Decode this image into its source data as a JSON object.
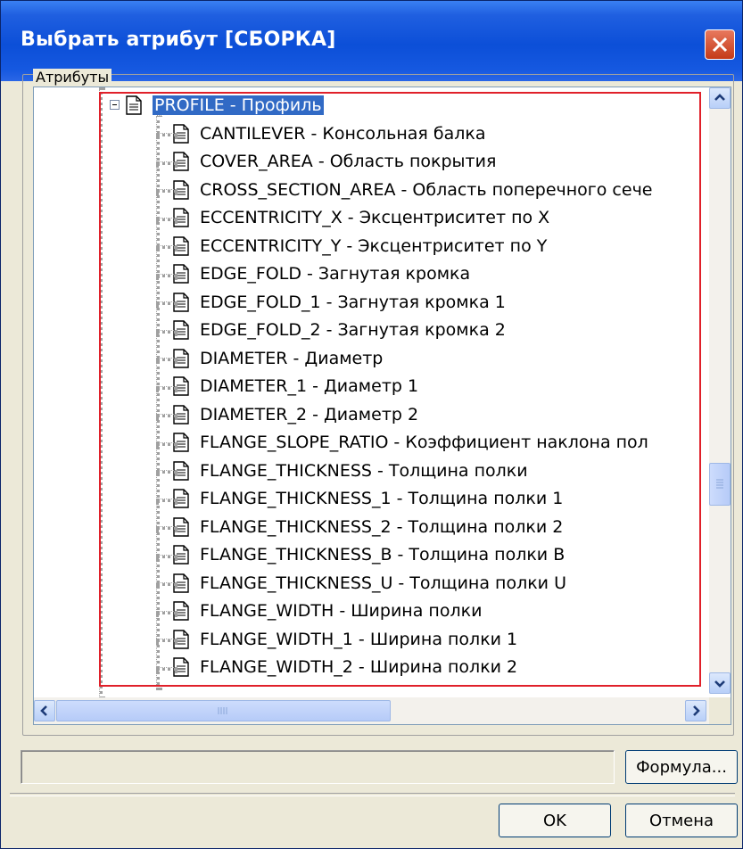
{
  "window": {
    "title": "Выбрать атрибут [СБОРКА]",
    "close_icon": "close-icon"
  },
  "group": {
    "label": "Атрибуты"
  },
  "tree": {
    "parent": {
      "label": "PROFILE  - Профиль",
      "expanded": true
    },
    "children": [
      {
        "label": "CANTILEVER  - Консольная балка"
      },
      {
        "label": "COVER_AREA  - Область покрытия"
      },
      {
        "label": "CROSS_SECTION_AREA  - Область поперечного сече"
      },
      {
        "label": "ECCENTRICITY_X  - Эксцентриситет по X"
      },
      {
        "label": "ECCENTRICITY_Y  - Эксцентриситет по Y"
      },
      {
        "label": "EDGE_FOLD  - Загнутая кромка"
      },
      {
        "label": "EDGE_FOLD_1  - Загнутая кромка 1"
      },
      {
        "label": "EDGE_FOLD_2  - Загнутая кромка 2"
      },
      {
        "label": "DIAMETER  - Диаметр"
      },
      {
        "label": "DIAMETER_1  - Диаметр 1"
      },
      {
        "label": "DIAMETER_2  - Диаметр 2"
      },
      {
        "label": "FLANGE_SLOPE_RATIO  - Коэффициент наклона пол"
      },
      {
        "label": "FLANGE_THICKNESS  - Толщина полки"
      },
      {
        "label": "FLANGE_THICKNESS_1  - Толщина полки 1"
      },
      {
        "label": "FLANGE_THICKNESS_2  - Толщина полки 2"
      },
      {
        "label": "FLANGE_THICKNESS_B  - Толщина полки B"
      },
      {
        "label": "FLANGE_THICKNESS_U  - Толщина полки U"
      },
      {
        "label": "FLANGE_WIDTH  - Ширина полки"
      },
      {
        "label": "FLANGE_WIDTH_1  - Ширина полки 1"
      },
      {
        "label": "FLANGE_WIDTH_2  - Ширина полки 2"
      }
    ]
  },
  "formula": {
    "value": "",
    "button_label": "Формула..."
  },
  "buttons": {
    "ok": "OK",
    "cancel": "Отмена"
  },
  "colors": {
    "titlebar": "#0c4fd8",
    "selection": "#316ac5",
    "highlight_border": "#e0202a"
  }
}
